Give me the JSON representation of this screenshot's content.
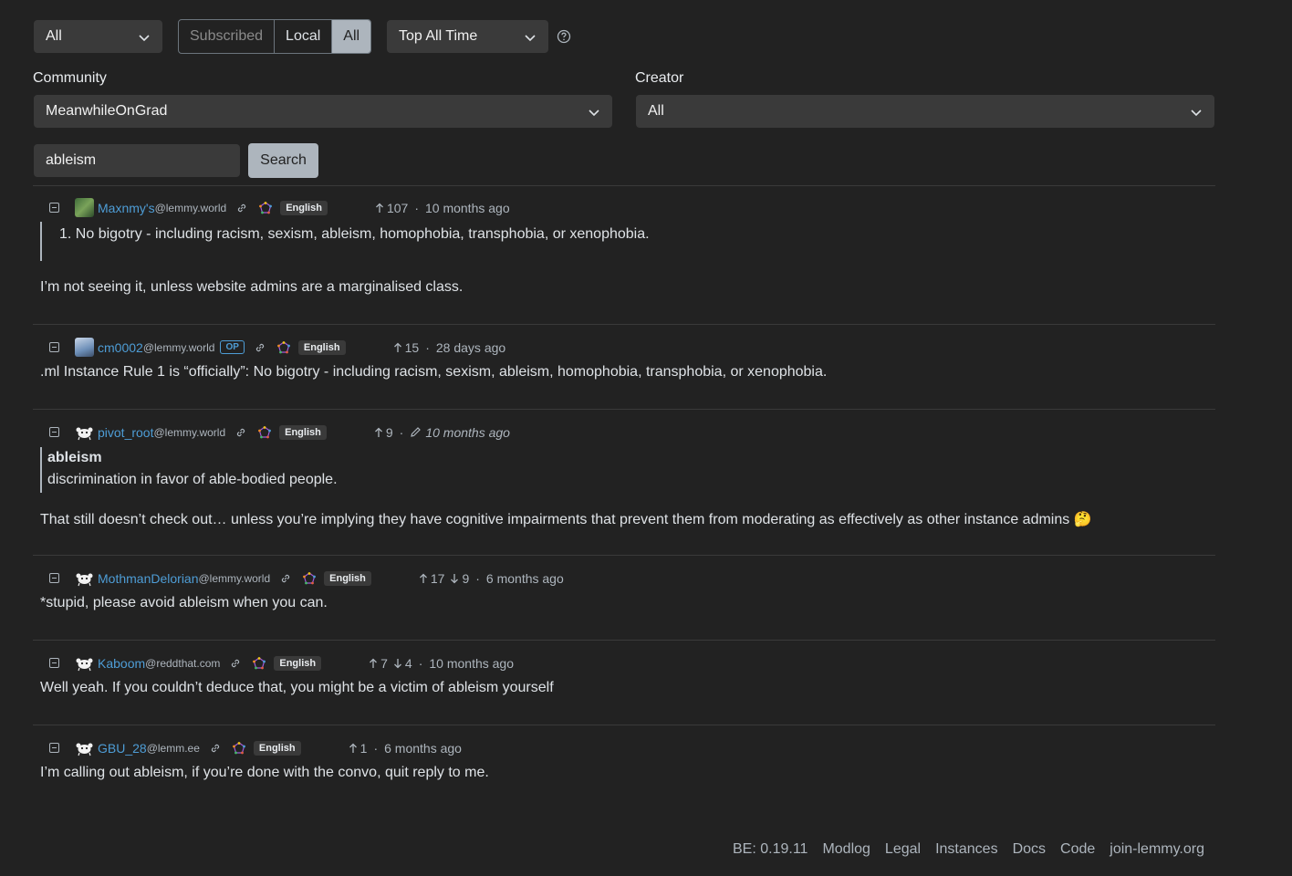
{
  "filters": {
    "type_select": "All",
    "listing": [
      "Subscribed",
      "Local",
      "All"
    ],
    "sort_select": "Top All Time",
    "community_label": "Community",
    "community_value": "MeanwhileOnGrad",
    "creator_label": "Creator",
    "creator_value": "All"
  },
  "search": {
    "value": "ableism",
    "button": "Search"
  },
  "comments": [
    {
      "user": "Maxnmy's",
      "instance": "@lemmy.world",
      "lang": "English",
      "up": "107",
      "time": "10 months ago",
      "quote_list_num": "1.",
      "quote_text": "No bigotry - including racism, sexism, ableism, homophobia, transphobia, or xenophobia.",
      "body": "I’m not seeing it, unless website admins are a marginalised class."
    },
    {
      "user": "cm0002",
      "instance": "@lemmy.world",
      "op": "OP",
      "lang": "English",
      "up": "15",
      "time": "28 days ago",
      "body": ".ml Instance Rule 1 is “officially”: No bigotry - including racism, sexism, ableism, homophobia, transphobia, or xenophobia."
    },
    {
      "user": "pivot_root",
      "instance": "@lemmy.world",
      "lang": "English",
      "up": "9",
      "time": "10 months ago",
      "quote_title": "ableism",
      "quote_text": "discrimination in favor of able-bodied people.",
      "body": "That still doesn’t check out… unless you’re implying they have cognitive impairments that prevent them from moderating as effectively as other instance admins 🤔"
    },
    {
      "user": "MothmanDelorian",
      "instance": "@lemmy.world",
      "lang": "English",
      "up": "17",
      "down": "9",
      "time": "6 months ago",
      "body": "*stupid, please avoid ableism when you can."
    },
    {
      "user": "Kaboom",
      "instance": "@reddthat.com",
      "lang": "English",
      "up": "7",
      "down": "4",
      "time": "10 months ago",
      "body": "Well yeah. If you couldn’t deduce that, you might be a victim of ableism yourself"
    },
    {
      "user": "GBU_28",
      "instance": "@lemm.ee",
      "lang": "English",
      "up": "1",
      "time": "6 months ago",
      "body": "I’m calling out ableism, if you’re done with the convo, quit reply to me."
    }
  ],
  "footer": [
    "BE: 0.19.11",
    "Modlog",
    "Legal",
    "Instances",
    "Docs",
    "Code",
    "join-lemmy.org"
  ]
}
